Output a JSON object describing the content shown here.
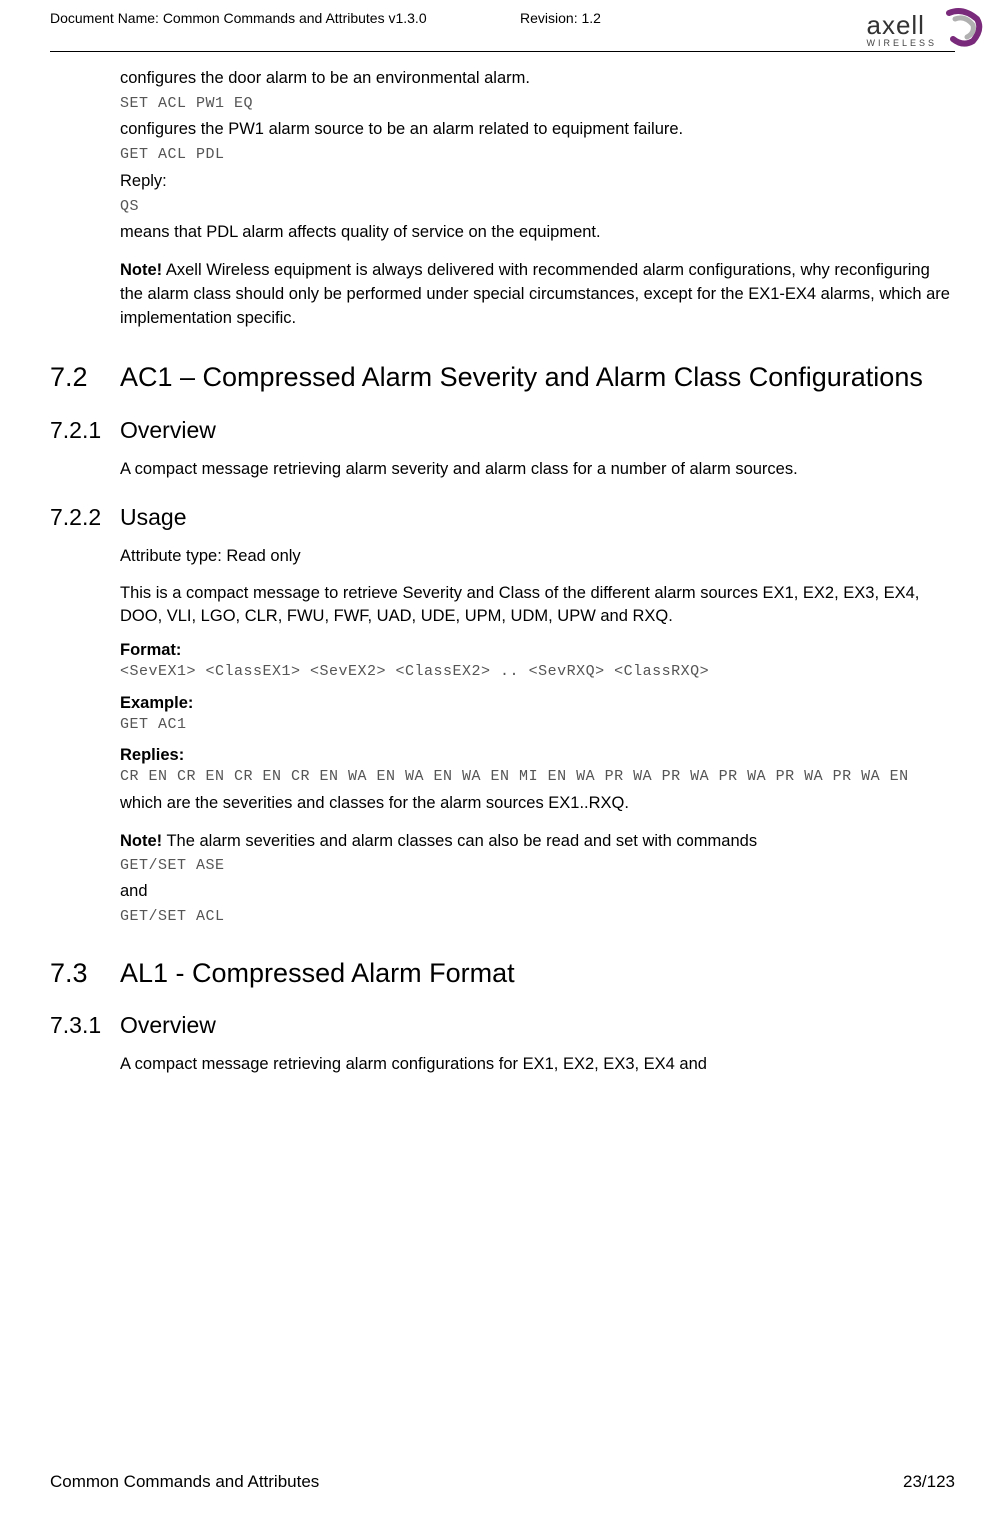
{
  "header": {
    "doc_name": "Document Name: Common Commands and Attributes v1.3.0",
    "revision": "Revision: 1.2",
    "logo_main": "axell",
    "logo_sub": "WIRELESS"
  },
  "intro": {
    "p1": "configures the door alarm to be an environmental alarm.",
    "code1": "SET ACL PW1 EQ",
    "p2": "configures the PW1 alarm source to be an alarm related to equipment failure.",
    "code2": "GET ACL PDL",
    "reply_label": "Reply:",
    "code3": "QS",
    "p3": "means that PDL alarm affects quality of service on the equipment.",
    "note_label": "Note!",
    "note_text": " Axell Wireless equipment is always delivered with recommended alarm configurations, why reconfiguring the alarm class should only be performed under special circumstances, except for the EX1-EX4 alarms, which are implementation specific."
  },
  "s72": {
    "num": "7.2",
    "title": "AC1 – Compressed Alarm Severity and Alarm Class Configurations",
    "s721_num": "7.2.1",
    "s721_title": "Overview",
    "s721_text": "A compact message retrieving alarm severity and alarm class for a number of alarm sources.",
    "s722_num": "7.2.2",
    "s722_title": "Usage",
    "attr_type": "Attribute type: Read only",
    "usage_desc": "This is a compact message to retrieve Severity and Class of the different alarm sources EX1, EX2, EX3, EX4, DOO,  VLI, LGO, CLR, FWU, FWF, UAD, UDE, UPM, UDM, UPW and RXQ.",
    "format_label": "Format:",
    "format_code": "<SevEX1> <ClassEX1> <SevEX2> <ClassEX2> .. <SevRXQ> <ClassRXQ>",
    "example_label": "Example:",
    "example_code": "GET AC1",
    "replies_label": "Replies:",
    "replies_code": "CR EN CR EN CR EN CR EN WA EN WA EN WA EN MI EN WA PR WA PR WA PR WA PR WA PR WA EN",
    "replies_text": "which are the severities and classes for the alarm sources EX1..RXQ.",
    "note_label": "Note!",
    "note_text": " The alarm severities and alarm classes can also be read and set with commands",
    "note_code1": "GET/SET ASE",
    "note_and": "and",
    "note_code2": "GET/SET ACL"
  },
  "s73": {
    "num": "7.3",
    "title": "AL1 - Compressed Alarm Format",
    "s731_num": "7.3.1",
    "s731_title": "Overview",
    "s731_text": "A compact message retrieving alarm configurations for EX1, EX2, EX3, EX4 and"
  },
  "footer": {
    "left": "Common Commands and Attributes",
    "right": "23/123"
  }
}
